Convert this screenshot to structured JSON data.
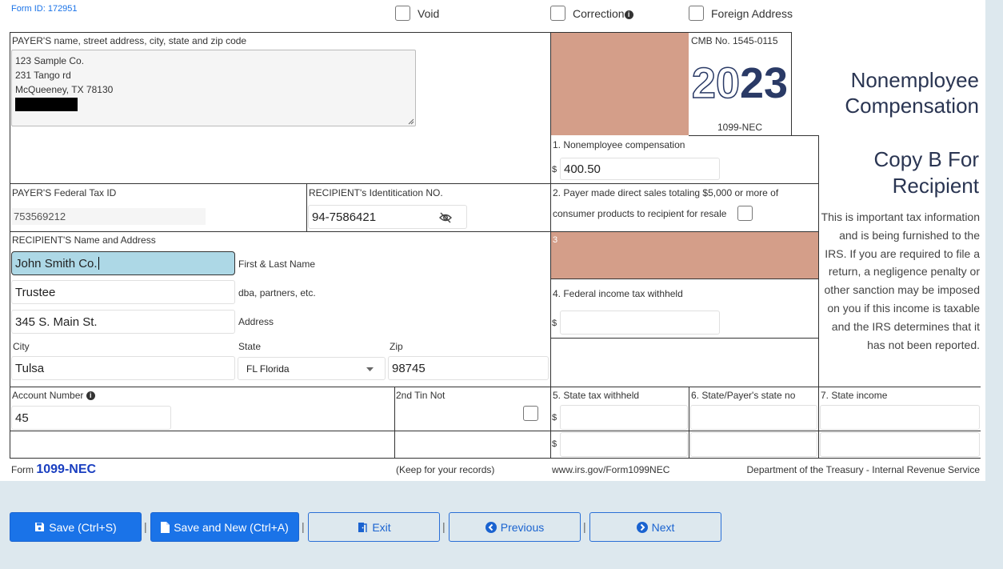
{
  "header": {
    "form_id": "Form ID: 172951",
    "void_label": "Void",
    "correction_label": "Correction",
    "foreign_label": "Foreign Address"
  },
  "payer": {
    "label": "PAYER'S name, street address, city, state and zip code",
    "lines": [
      "123 Sample Co.",
      "231 Tango rd",
      "McQueeney, TX 78130"
    ]
  },
  "omb": {
    "number": "CMB No. 1545-0115",
    "year_light": "20",
    "year_bold": "23",
    "form_name": "1099-NEC"
  },
  "title": {
    "line1": "Nonemployee",
    "line2": "Compensation",
    "copy1": "Copy B For",
    "copy2": "Recipient",
    "notice": "This is important tax information and is being furnished to the IRS. If you are required to file a return, a negligence penalty or other sanction may be imposed on you if this income is taxable and the IRS determines that it has not been reported."
  },
  "box1": {
    "label": "1. Nonemployee compensation",
    "currency": "$",
    "value": "400.50"
  },
  "tax_ids": {
    "payer_label": "PAYER'S Federal Tax ID",
    "payer_value": "753569212",
    "recipient_label": "RECIPIENT's Identitication NO.",
    "recipient_value": "94-7586421"
  },
  "box2": {
    "label_line1": "2. Payer made direct sales totaling $5,000 or more of",
    "label_line2": "consumer products to recipient for resale"
  },
  "box3": {
    "label": "3"
  },
  "box4": {
    "label": "4. Federal income tax withheld",
    "currency": "$",
    "value": ""
  },
  "recipient": {
    "label": "RECIPIENT'S Name and Address",
    "name": "John Smith Co.",
    "name_hint": "First & Last Name",
    "dba": "Trustee",
    "dba_hint": "dba, partners, etc.",
    "address": "345 S. Main St.",
    "address_hint": "Address",
    "city_label": "City",
    "city": "Tulsa",
    "state_label": "State",
    "state": "FL Florida",
    "zip_label": "Zip",
    "zip": "98745"
  },
  "account": {
    "label": "Account Number",
    "value": "45",
    "tin_label": "2nd Tin Not"
  },
  "state_boxes": {
    "box5_label": "5. State tax withheld",
    "box6_label": "6. State/Payer's state no",
    "box7_label": "7. State income",
    "currency": "$"
  },
  "footer": {
    "form_prefix": "Form",
    "form_name": "1099-NEC",
    "keep": "(Keep for your records)",
    "url": "www.irs.gov/Form1099NEC",
    "dept": "Department of the Treasury - Internal Revenue Service"
  },
  "actions": {
    "save": "Save (Ctrl+S)",
    "save_new": "Save and New (Ctrl+A)",
    "exit": "Exit",
    "previous": "Previous",
    "next": "Next",
    "separator": "|"
  }
}
